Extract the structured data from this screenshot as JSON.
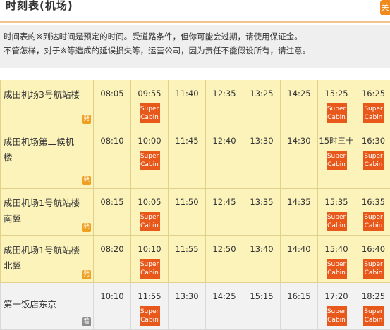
{
  "header": {
    "title": "时刻表(机场)",
    "side_button": "关"
  },
  "notice": {
    "line1": "时间表的※到达时间是预定的时间。受道路条件，但你可能会过期，请使用保证金。",
    "line2": "不管怎样，对于※等造成的延误损失等，运营公司，因为责任不能假设所有，请注意。"
  },
  "super_cabin_label": [
    "Super",
    "Cabin"
  ],
  "rows": [
    {
      "stop": "成田机场3号航站楼",
      "badge": "発",
      "times": [
        "08:05",
        "09:55",
        "11:40",
        "12:35",
        "13:25",
        "14:25",
        "15:25",
        "16:25"
      ],
      "super_cabin": [
        false,
        true,
        false,
        false,
        false,
        false,
        true,
        true
      ]
    },
    {
      "stop": "成田机场第二候机楼",
      "badge": "発",
      "times": [
        "08:10",
        "10:00",
        "11:45",
        "12:40",
        "13:30",
        "14:30",
        "15时三十",
        "16:30"
      ],
      "super_cabin": [
        false,
        true,
        false,
        false,
        false,
        false,
        true,
        true
      ]
    },
    {
      "stop": "成田机场1号航站楼南翼",
      "badge": "発",
      "times": [
        "08:15",
        "10:05",
        "11:50",
        "12:45",
        "13:35",
        "14:35",
        "15:35",
        "16:35"
      ],
      "super_cabin": [
        false,
        true,
        false,
        false,
        false,
        false,
        true,
        true
      ]
    },
    {
      "stop": "成田机场1号航站楼北翼",
      "badge": "発",
      "times": [
        "08:20",
        "10:10",
        "11:55",
        "12:50",
        "13:40",
        "14:40",
        "15:40",
        "16:40"
      ],
      "super_cabin": [
        false,
        true,
        false,
        false,
        false,
        false,
        true,
        true
      ]
    },
    {
      "stop": "第一饭店东京",
      "badge": "着",
      "times": [
        "10:10",
        "11:55",
        "13:30",
        "14:25",
        "15:15",
        "16:15",
        "17:20",
        "18:25"
      ],
      "super_cabin": [
        false,
        true,
        false,
        false,
        false,
        false,
        true,
        true
      ]
    }
  ]
}
